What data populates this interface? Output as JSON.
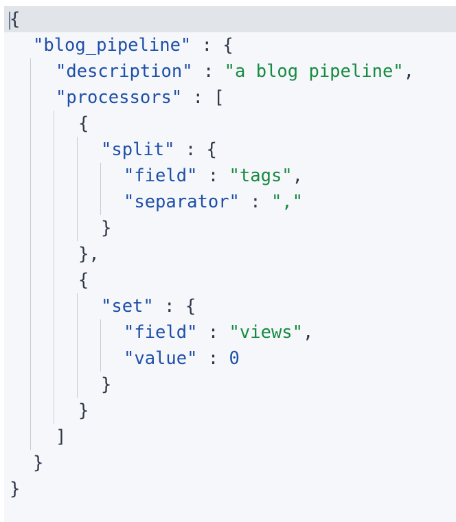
{
  "lines": [
    {
      "punc1": "{"
    },
    {
      "key": "\"blog_pipeline\"",
      "sep": " : ",
      "punc1": "{"
    },
    {
      "key": "\"description\"",
      "sep": " : ",
      "val": "\"a blog pipeline\"",
      "punc2": ","
    },
    {
      "key": "\"processors\"",
      "sep": " : ",
      "punc1": "["
    },
    {
      "punc1": "{"
    },
    {
      "key": "\"split\"",
      "sep": " : ",
      "punc1": "{"
    },
    {
      "key": "\"field\"",
      "sep": " : ",
      "val": "\"tags\"",
      "punc2": ","
    },
    {
      "key": "\"separator\"",
      "sep": " : ",
      "val": "\",\""
    },
    {
      "punc1": "}"
    },
    {
      "punc1": "},"
    },
    {
      "punc1": "{"
    },
    {
      "key": "\"set\"",
      "sep": " : ",
      "punc1": "{"
    },
    {
      "key": "\"field\"",
      "sep": " : ",
      "val": "\"views\"",
      "punc2": ","
    },
    {
      "key": "\"value\"",
      "sep": " : ",
      "num": "0"
    },
    {
      "punc1": "}"
    },
    {
      "punc1": "}"
    },
    {
      "punc1": "]"
    },
    {
      "punc1": "}"
    },
    {
      "punc1": "}"
    }
  ],
  "colors": {
    "key": "#1e4fa8",
    "string": "#168a40",
    "punctuation": "#2d3748",
    "background": "#f5f7fa",
    "active_line": "#e1e4e9",
    "indent_guide": "#c7ccd4"
  }
}
